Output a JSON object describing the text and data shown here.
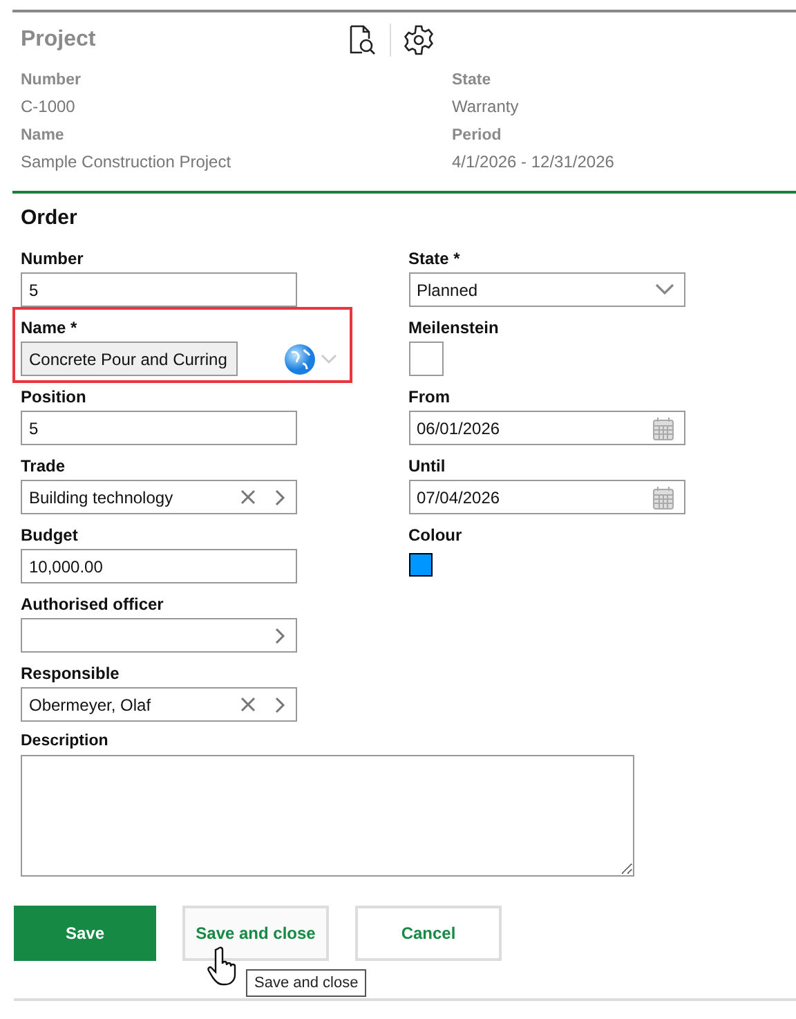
{
  "project": {
    "title": "Project",
    "fields": [
      {
        "label": "Number",
        "value": "C-1000"
      },
      {
        "label": "State",
        "value": "Warranty"
      },
      {
        "label": "Name",
        "value": "Sample Construction Project"
      },
      {
        "label": "Period",
        "value": "4/1/2026 - 12/31/2026"
      }
    ]
  },
  "order": {
    "title": "Order",
    "left_fields": [
      {
        "kind": "text",
        "label": "Number",
        "value": "5"
      },
      {
        "kind": "translated",
        "label": "Name *",
        "value": "Concrete Pour and Curring",
        "highlighted": true
      },
      {
        "kind": "text",
        "label": "Position",
        "value": "5"
      },
      {
        "kind": "lookup",
        "label": "Trade",
        "value": "Building technology"
      },
      {
        "kind": "text",
        "label": "Budget",
        "value": "10,000.00"
      },
      {
        "kind": "lookup",
        "label": "Authorised officer"
      },
      {
        "kind": "lookup",
        "label": "Responsible",
        "value": "Obermeyer, Olaf"
      }
    ],
    "right_fields": [
      {
        "kind": "select",
        "label": "State *",
        "value": "Planned"
      },
      {
        "kind": "checkbox",
        "label": "Meilenstein",
        "checked": false
      },
      {
        "kind": "date",
        "label": "From",
        "value": "06/01/2026"
      },
      {
        "kind": "date",
        "label": "Until",
        "value": "07/04/2026"
      },
      {
        "kind": "color",
        "label": "Colour",
        "color": "#0096ff"
      }
    ],
    "description": {
      "label": "Description"
    }
  },
  "buttons": [
    {
      "label": "Save",
      "kind": "primary",
      "hovered": false
    },
    {
      "label": "Save and close",
      "kind": "secondary",
      "hovered": true
    },
    {
      "label": "Cancel",
      "kind": "secondary",
      "hovered": false
    }
  ],
  "tooltip": "Save and close"
}
